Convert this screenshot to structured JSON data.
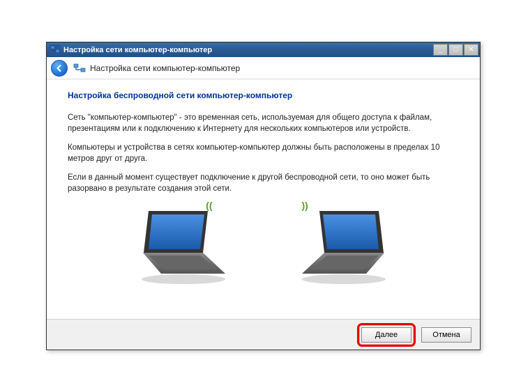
{
  "titlebar": {
    "text": "Настройка сети компьютер-компьютер"
  },
  "window_controls": {
    "minimize": "_",
    "maximize": "□",
    "close": "✕"
  },
  "header": {
    "title": "Настройка сети компьютер-компьютер"
  },
  "content": {
    "heading": "Настройка беспроводной сети компьютер-компьютер",
    "para1": "Сеть \"компьютер-компьютер\" - это временная сеть, используемая для общего доступа к файлам, презентациям или к подключению к Интернету для нескольких компьютеров или устройств.",
    "para2": "Компьютеры и устройства в сетях компьютер-компьютер должны быть расположены в пределах 10 метров друг от друга.",
    "para3": "Если в данный момент существует подключение к другой беспроводной сети, то оно может быть разорвано в результате создания этой сети."
  },
  "footer": {
    "next": "Далее",
    "cancel": "Отмена"
  }
}
